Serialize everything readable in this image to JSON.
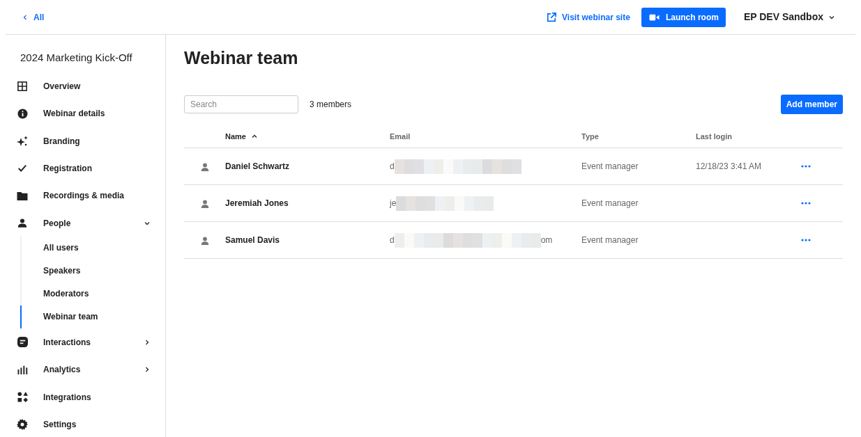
{
  "topbar": {
    "back_link": "All",
    "visit_link": "Visit webinar site",
    "launch_button": "Launch room",
    "account_menu": "EP DEV Sandbox"
  },
  "sidebar": {
    "title": "2024 Marketing Kick-Off",
    "items": [
      {
        "label": "Overview"
      },
      {
        "label": "Webinar details"
      },
      {
        "label": "Branding"
      },
      {
        "label": "Registration"
      },
      {
        "label": "Recordings & media"
      },
      {
        "label": "People",
        "expanded": true,
        "children": [
          {
            "label": "All users",
            "selected": false
          },
          {
            "label": "Speakers",
            "selected": false
          },
          {
            "label": "Moderators",
            "selected": false
          },
          {
            "label": "Webinar team",
            "selected": true
          }
        ]
      },
      {
        "label": "Interactions",
        "expanded": false
      },
      {
        "label": "Analytics",
        "expanded": false
      },
      {
        "label": "Integrations"
      },
      {
        "label": "Settings"
      }
    ]
  },
  "main": {
    "title": "Webinar team",
    "search": {
      "placeholder": "Search"
    },
    "member_count": "3 members",
    "add_button": "Add member",
    "table": {
      "columns": [
        "Name",
        "Email",
        "Type",
        "Last login"
      ],
      "rows": [
        {
          "name": "Daniel Schwartz",
          "email_start": "d",
          "type": "Event manager",
          "last_login": "12/18/23 3:41 AM"
        },
        {
          "name": "Jeremiah Jones",
          "email_start": "je",
          "type": "Event manager"
        },
        {
          "name": "Samuel Davis",
          "email_start": "d",
          "email_end": "om",
          "type": "Event manager"
        }
      ]
    }
  }
}
